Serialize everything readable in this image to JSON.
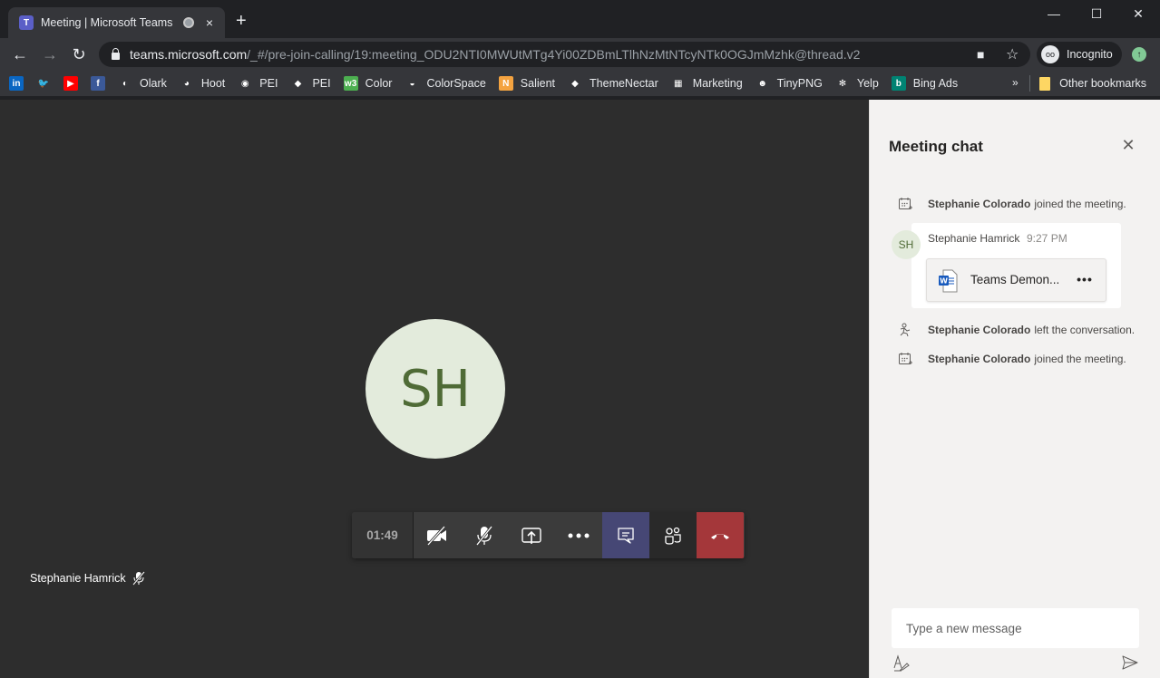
{
  "browser": {
    "tab": {
      "title": "Meeting | Microsoft Teams",
      "favicon": "teams-icon",
      "close_glyph": "×"
    },
    "new_tab_glyph": "+",
    "window_controls": {
      "minimize": "—",
      "maximize": "☐",
      "close": "✕"
    },
    "nav": {
      "back": "←",
      "forward": "→",
      "reload": "↻"
    },
    "url": {
      "host": "teams.microsoft.com",
      "path": "/_#/pre-join-calling/19:meeting_ODU2NTI0MWUtMTg4Yi00ZDBmLTlhNzMtNTcyNTk0OGJmMzhk@thread.v2"
    },
    "omnibox_icons": {
      "camera": "■",
      "star": "☆"
    },
    "profile": {
      "label": "Incognito",
      "icon": "oo"
    },
    "update_glyph": "↑",
    "bookmarks": [
      {
        "label": "",
        "icon": "in",
        "color": "#0a66c2"
      },
      {
        "label": "",
        "icon": "🐦",
        "color": "transparent"
      },
      {
        "label": "",
        "icon": "▶",
        "color": "#ff0000"
      },
      {
        "label": "",
        "icon": "f",
        "color": "#3b5998"
      },
      {
        "label": "Olark",
        "icon": "◐",
        "color": "transparent"
      },
      {
        "label": "Hoot",
        "icon": "◕",
        "color": "transparent"
      },
      {
        "label": "PEI",
        "icon": "◉",
        "color": "transparent"
      },
      {
        "label": "PEI",
        "icon": "◆",
        "color": "transparent"
      },
      {
        "label": "Color",
        "icon": "w3",
        "color": "#4caf50"
      },
      {
        "label": "ColorSpace",
        "icon": "◒",
        "color": "transparent"
      },
      {
        "label": "Salient",
        "icon": "N",
        "color": "#f4a340"
      },
      {
        "label": "ThemeNectar",
        "icon": "◆",
        "color": "transparent"
      },
      {
        "label": "Marketing",
        "icon": "▦",
        "color": "transparent"
      },
      {
        "label": "TinyPNG",
        "icon": "☻",
        "color": "transparent"
      },
      {
        "label": "Yelp",
        "icon": "✻",
        "color": "transparent"
      },
      {
        "label": "Bing Ads",
        "icon": "b",
        "color": "#008373"
      }
    ],
    "overflow_glyph": "»",
    "other_bookmarks": "Other bookmarks"
  },
  "meeting": {
    "participant_initials": "SH",
    "participant_name": "Stephanie Hamrick",
    "call_timer": "01:49",
    "controls": [
      {
        "name": "camera-off",
        "label": "Turn camera on"
      },
      {
        "name": "mic-off",
        "label": "Unmute"
      },
      {
        "name": "share",
        "label": "Share"
      },
      {
        "name": "more",
        "label": "More actions"
      },
      {
        "name": "chat",
        "label": "Show conversation"
      },
      {
        "name": "participants",
        "label": "Show participants"
      },
      {
        "name": "hang-up",
        "label": "Hang up"
      }
    ],
    "colors": {
      "avatar_bg": "#e3ebdc",
      "avatar_fg": "#4f6b36",
      "active_control": "#464775",
      "hangup": "#a4373a"
    }
  },
  "chat": {
    "title": "Meeting chat",
    "close_glyph": "✕",
    "events": [
      {
        "actor": "Stephanie Colorado",
        "text": "joined the meeting.",
        "icon": "calendar-join"
      },
      {
        "actor": "Stephanie Colorado",
        "text": "left the conversation.",
        "icon": "person-leave"
      },
      {
        "actor": "Stephanie Colorado",
        "text": "joined the meeting.",
        "icon": "calendar-join"
      }
    ],
    "message": {
      "initials": "SH",
      "sender": "Stephanie Hamrick",
      "time": "9:27 PM",
      "file_name": "Teams Demon...",
      "file_more": "•••"
    },
    "compose": {
      "placeholder": "Type a new message",
      "value": ""
    }
  }
}
